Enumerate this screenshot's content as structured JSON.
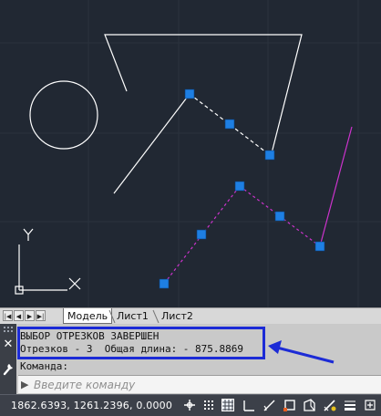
{
  "tabs": {
    "model": "Модель",
    "layout1": "Лист1",
    "layout2": "Лист2"
  },
  "navigation": {
    "first": "first-icon",
    "prev": "prev-icon",
    "next": "next-icon",
    "last": "last-icon"
  },
  "command_window": {
    "history_line1": "ВЫБОР ОТРЕЗКОВ ЗАВЕРШЕН",
    "history_line2": "Отрезков - 3  Общая длина: - 875.8869",
    "prompt": "Команда:",
    "input_placeholder": "Введите команду"
  },
  "status_bar": {
    "coordinates": "1862.6393, 1261.2396, 0.0000",
    "buttons": [
      "snap-icon",
      "grid-icon",
      "ortho-icon",
      "polar-icon",
      "osnap-icon",
      "otrack-icon",
      "dynucs-icon",
      "dyn-icon",
      "lineweight-icon"
    ]
  },
  "ucs": {
    "y_label": "Y",
    "x_label": "X"
  },
  "colors": {
    "canvas_background": "#212833",
    "entity_white": "#ffffff",
    "entity_magenta": "#cc33cc",
    "grip_blue": "#1e7fe3",
    "highlight_border": "#1c2bd6",
    "annotation_arrow": "#1c2bd6"
  }
}
